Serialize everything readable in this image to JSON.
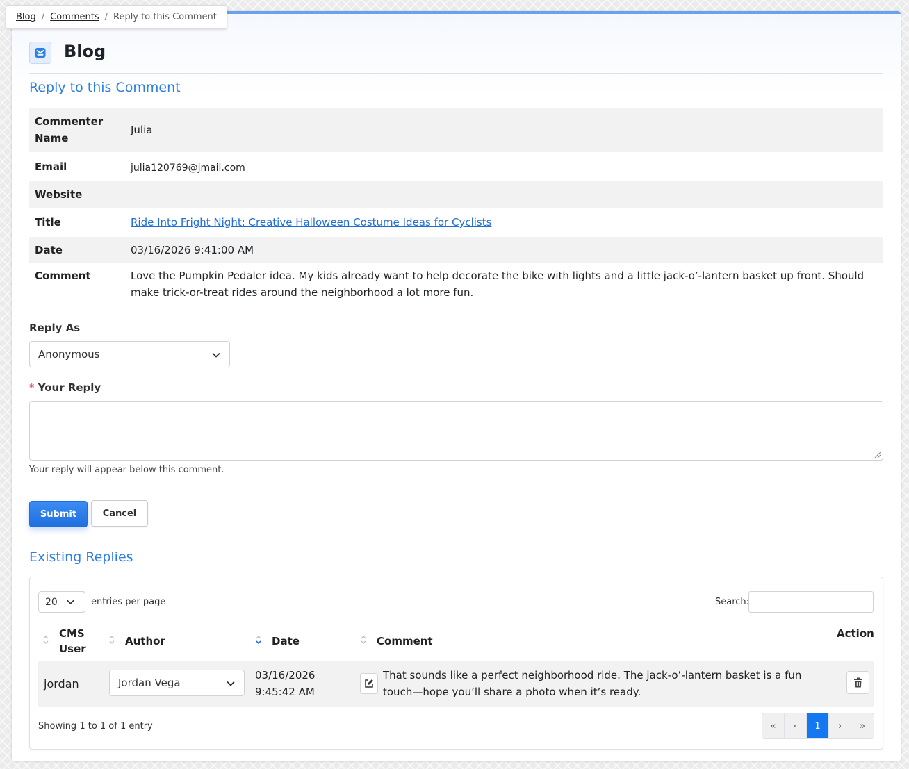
{
  "breadcrumb": {
    "items": [
      "Blog",
      "Comments"
    ],
    "current": "Reply to this Comment",
    "separator": "/"
  },
  "app": {
    "title": "Blog",
    "icon": "inbox-icon"
  },
  "section_title": "Reply to this Comment",
  "details": {
    "commenter_name_label": "Commenter Name",
    "commenter_name": "Julia",
    "email_label": "Email",
    "email": "julia120769@jmail.com",
    "website_label": "Website",
    "website": "",
    "title_label": "Title",
    "title": "Ride Into Fright Night: Creative Halloween Costume Ideas for Cyclists",
    "date_label": "Date",
    "date": "03/16/2026 9:41:00 AM",
    "comment_label": "Comment",
    "comment": "Love the Pumpkin Pedaler idea. My kids already want to help decorate the bike with lights and a little jack-o’-lantern basket up front. Should make trick-or-treat rides around the neighborhood a lot more fun."
  },
  "form": {
    "reply_as_label": "Reply As",
    "reply_as_value": "Anonymous",
    "your_reply_label": "Your Reply",
    "required_mark": "*",
    "reply_value": "",
    "help_text": "Your reply will appear below this comment.",
    "submit_label": "Submit",
    "cancel_label": "Cancel"
  },
  "existing": {
    "title": "Existing Replies",
    "page_size": "20",
    "entries_label": "entries per page",
    "search_label": "Search:",
    "search_value": "",
    "columns": {
      "cms_user": "CMS User",
      "author": "Author",
      "date": "Date",
      "comment": "Comment",
      "action": "Action"
    },
    "rows": [
      {
        "cms_user": "jordan",
        "author": "Jordan Vega",
        "date_line1": "03/16/2026",
        "date_line2": "9:45:42 AM",
        "comment": "That sounds like a perfect neighborhood ride. The jack-o’-lantern basket is a fun touch—hope you’ll share a photo when it’s ready."
      }
    ],
    "showing": "Showing 1 to 1 of 1 entry",
    "pager": {
      "first": "«",
      "prev": "‹",
      "current": "1",
      "next": "›",
      "last": "»"
    }
  },
  "colors": {
    "accent": "#2d7fe0",
    "primary_button": "#1f6fde",
    "page_active": "#1477f2",
    "required": "#dc3545"
  }
}
